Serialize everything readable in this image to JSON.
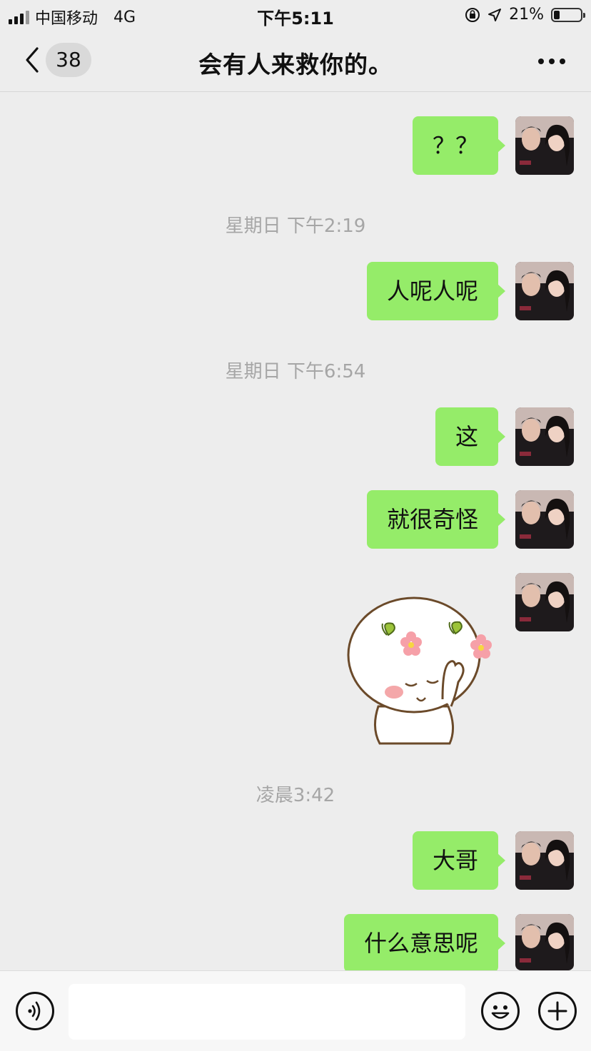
{
  "status_bar": {
    "carrier": "中国移动",
    "network": "4G",
    "time": "下午5:11",
    "battery_percent": "21%",
    "battery_level": 0.21
  },
  "nav": {
    "unread_count": "38",
    "title": "会有人来救你的。"
  },
  "messages": [
    {
      "kind": "text",
      "text": "？？"
    },
    {
      "kind": "time",
      "text": "星期日 下午2:19"
    },
    {
      "kind": "text",
      "text": "人呢人呢"
    },
    {
      "kind": "time",
      "text": "星期日 下午6:54"
    },
    {
      "kind": "text",
      "text": "这"
    },
    {
      "kind": "text",
      "text": "就很奇怪"
    },
    {
      "kind": "sticker",
      "icon": "cartoon-bun-sticker"
    },
    {
      "kind": "time",
      "text": "凌晨3:42"
    },
    {
      "kind": "text",
      "text": "大哥"
    },
    {
      "kind": "text",
      "text": "什么意思呢"
    }
  ],
  "input": {
    "value": ""
  },
  "colors": {
    "chat_background": "#ededed",
    "bubble_green": "#95ec69",
    "timestamp_gray": "#a6a6a6"
  }
}
